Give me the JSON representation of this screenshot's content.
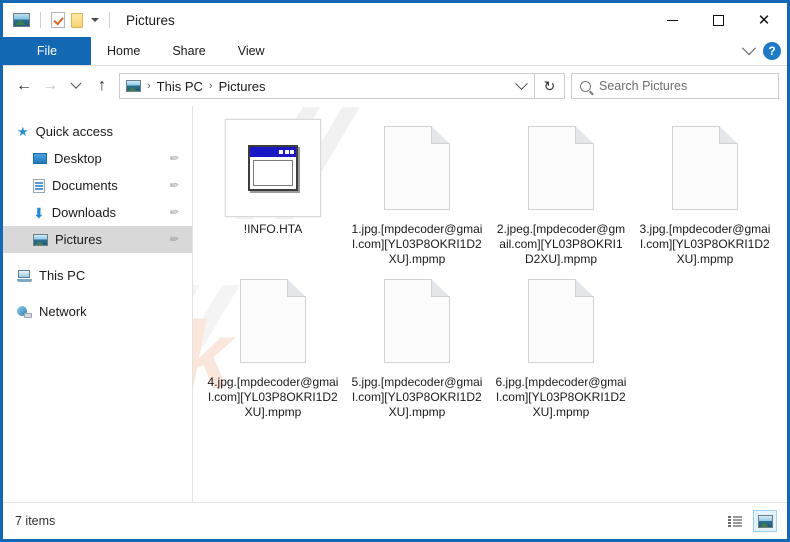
{
  "window": {
    "title": "Pictures",
    "controls": {
      "minimize": "—",
      "maximize": "□",
      "close": "✕"
    }
  },
  "quick_access_toolbar": {
    "items": [
      {
        "name": "picture-icon",
        "label": ""
      },
      {
        "name": "properties-icon",
        "label": ""
      },
      {
        "name": "new-folder-icon",
        "label": ""
      }
    ],
    "customize_caret": ""
  },
  "ribbon": {
    "tabs": [
      {
        "label": "File",
        "active": true
      },
      {
        "label": "Home",
        "active": false
      },
      {
        "label": "Share",
        "active": false
      },
      {
        "label": "View",
        "active": false
      }
    ],
    "expand_label": "",
    "help_label": "?"
  },
  "addressbar": {
    "back": "←",
    "forward": "→",
    "recent": "",
    "up": "↑",
    "breadcrumbs": [
      "This PC",
      "Pictures"
    ],
    "separator": "›",
    "refresh": "↻"
  },
  "search": {
    "placeholder": "Search Pictures",
    "value": ""
  },
  "sidebar": {
    "items": [
      {
        "label": "Quick access",
        "icon": "star-icon",
        "level": 0,
        "pinned": false,
        "selected": false
      },
      {
        "label": "Desktop",
        "icon": "desktop-icon",
        "level": 1,
        "pinned": true,
        "selected": false
      },
      {
        "label": "Documents",
        "icon": "documents-icon",
        "level": 1,
        "pinned": true,
        "selected": false
      },
      {
        "label": "Downloads",
        "icon": "downloads-icon",
        "level": 1,
        "pinned": true,
        "selected": false
      },
      {
        "label": "Pictures",
        "icon": "pictures-icon",
        "level": 1,
        "pinned": true,
        "selected": true
      },
      {
        "label": "This PC",
        "icon": "this-pc-icon",
        "level": 0,
        "pinned": false,
        "selected": false
      },
      {
        "label": "Network",
        "icon": "network-icon",
        "level": 0,
        "pinned": false,
        "selected": false
      }
    ],
    "pin_glyph": "✐"
  },
  "files": [
    {
      "name": "!INFO.HTA",
      "icon": "hta-window-icon"
    },
    {
      "name": "1.jpg.[mpdecoder@gmail.com][YL03P8OKRI1D2XU].mpmp",
      "icon": "blank-file-icon"
    },
    {
      "name": "2.jpeg.[mpdecoder@gmail.com][YL03P8OKRI1D2XU].mpmp",
      "icon": "blank-file-icon"
    },
    {
      "name": "3.jpg.[mpdecoder@gmail.com][YL03P8OKRI1D2XU].mpmp",
      "icon": "blank-file-icon"
    },
    {
      "name": "4.jpg.[mpdecoder@gmail.com][YL03P8OKRI1D2XU].mpmp",
      "icon": "blank-file-icon"
    },
    {
      "name": "5.jpg.[mpdecoder@gmail.com][YL03P8OKRI1D2XU].mpmp",
      "icon": "blank-file-icon"
    },
    {
      "name": "6.jpg.[mpdecoder@gmail.com][YL03P8OKRI1D2XU].mpmp",
      "icon": "blank-file-icon"
    }
  ],
  "watermarks": {
    "grey_top": "//",
    "grey_bottom": "//",
    "brand": "risk"
  },
  "statusbar": {
    "item_count": "7 items",
    "views": [
      {
        "name": "details-view",
        "active": false
      },
      {
        "name": "large-icons-view",
        "active": true
      }
    ]
  },
  "colors": {
    "window_border": "#1268b3",
    "file_tab": "#1268b3",
    "selection": "#d8d8d8",
    "hta_titlebar": "#1a17c4",
    "watermark_brand": "#fbe6dc"
  }
}
